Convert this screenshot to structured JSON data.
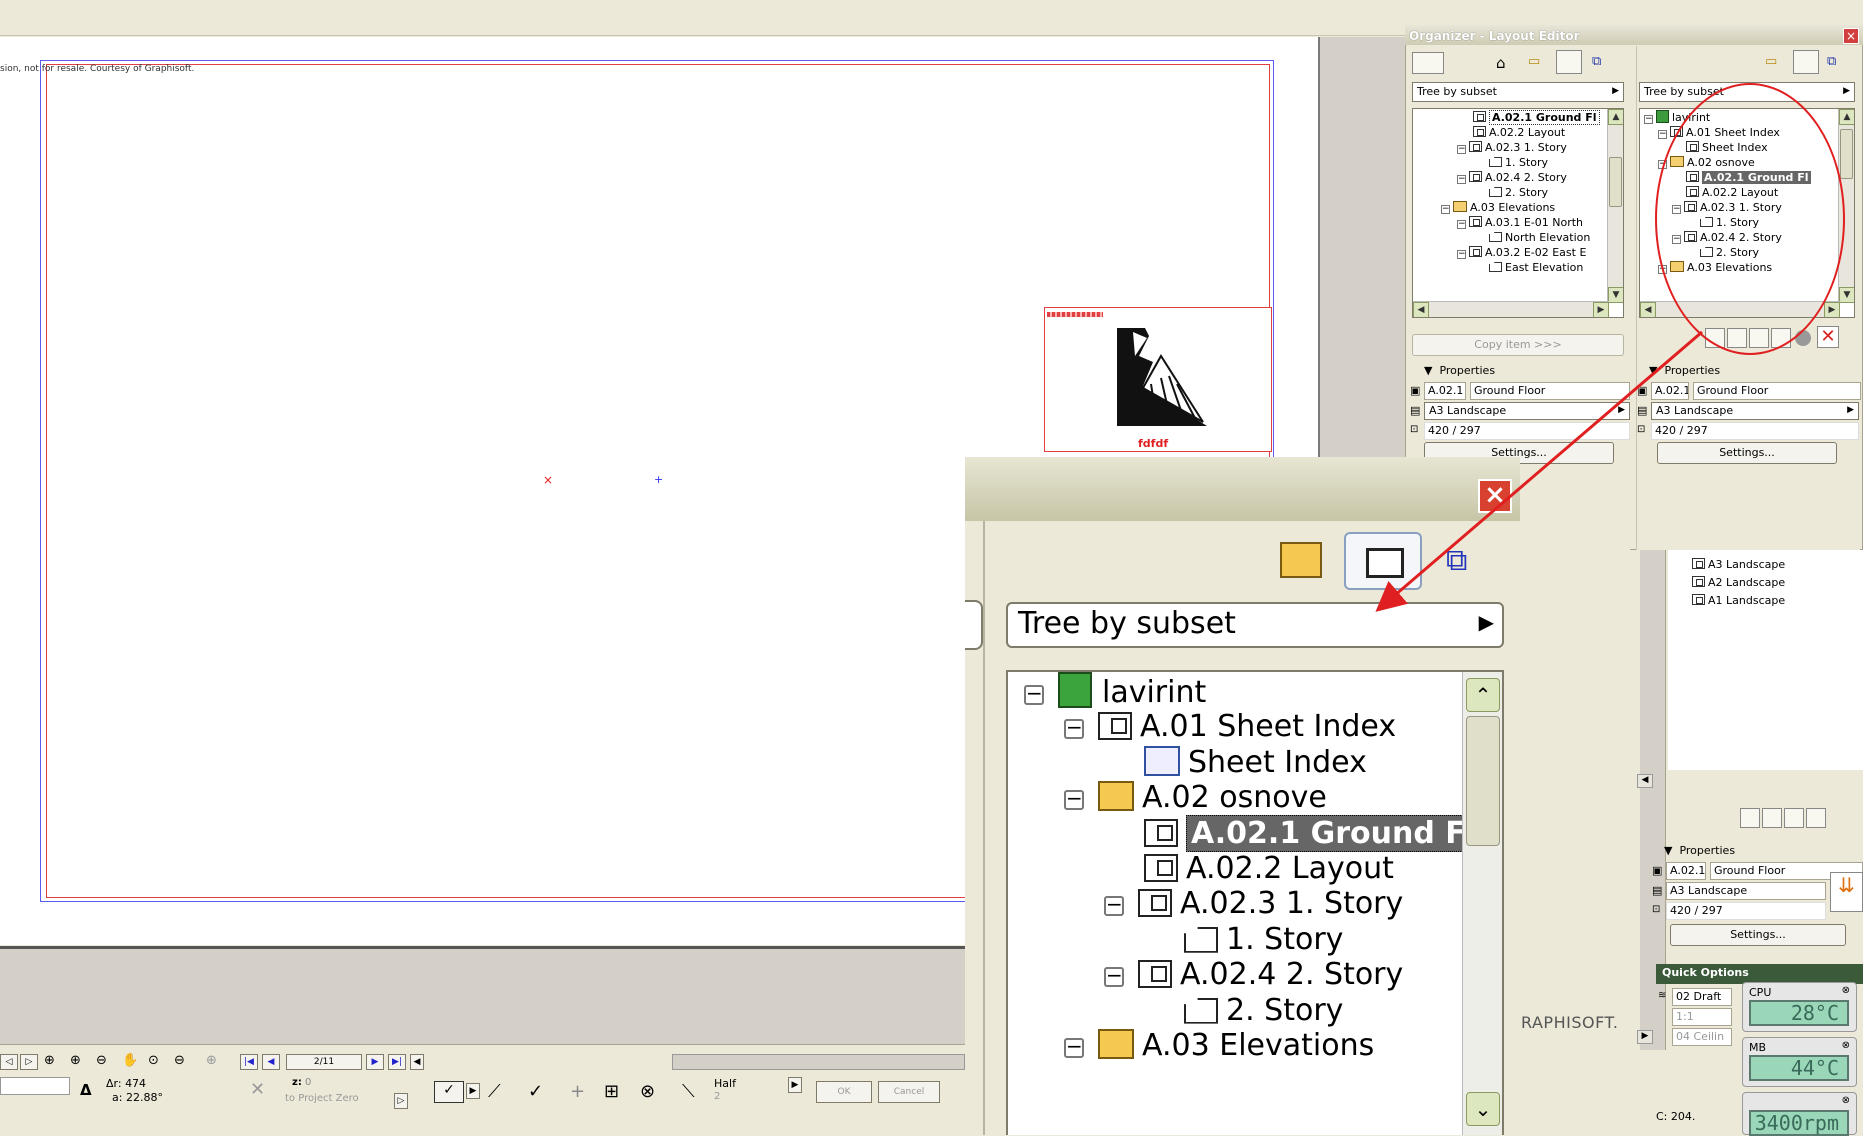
{
  "canvas": {
    "courtesy": "sion, not for resale. Courtesy of Graphisoft.",
    "titleblock_label": "fdfdf"
  },
  "statusbar": {
    "page_counter": "2/11",
    "delta_r_label": "Δr:",
    "delta_r": "474",
    "angle_label": "a:",
    "angle": "22.88°",
    "z_label": "z:",
    "z_value": "0",
    "z_ref": "to Project Zero",
    "half_label": "Half",
    "half_value": "2",
    "ok": "OK",
    "cancel": "Cancel"
  },
  "organizer": {
    "title": "Organizer - Layout Editor",
    "left": {
      "dropdown": "Tree by subset",
      "items": [
        {
          "label": "A.02.1 Ground Fl",
          "indent": 3,
          "icon": "layout",
          "state": "selected"
        },
        {
          "label": "A.02.2 Layout",
          "indent": 3,
          "icon": "layout"
        },
        {
          "label": "A.02.3 1. Story",
          "indent": 2,
          "icon": "layout",
          "exp": "−"
        },
        {
          "label": "1. Story",
          "indent": 4,
          "icon": "view"
        },
        {
          "label": "A.02.4 2. Story",
          "indent": 2,
          "icon": "layout",
          "exp": "−"
        },
        {
          "label": "2. Story",
          "indent": 4,
          "icon": "view"
        },
        {
          "label": "A.03 Elevations",
          "indent": 1,
          "icon": "folder",
          "exp": "−"
        },
        {
          "label": "A.03.1 E-01 North",
          "indent": 2,
          "icon": "layout",
          "exp": "−"
        },
        {
          "label": "North Elevation",
          "indent": 4,
          "icon": "view"
        },
        {
          "label": "A.03.2 E-02 East E",
          "indent": 2,
          "icon": "layout",
          "exp": "−"
        },
        {
          "label": "East Elevation",
          "indent": 4,
          "icon": "view"
        }
      ],
      "copy_btn": "Copy item >>>",
      "properties_title": "Properties",
      "prop_id": "A.02.1",
      "prop_name": "Ground Floor",
      "prop_format": "A3 Landscape",
      "prop_size": "420 / 297",
      "settings": "Settings..."
    },
    "right": {
      "dropdown": "Tree by subset",
      "items": [
        {
          "label": "lavirint",
          "indent": 0,
          "icon": "book",
          "exp": "−"
        },
        {
          "label": "A.01 Sheet Index",
          "indent": 1,
          "icon": "layout",
          "exp": "−"
        },
        {
          "label": "Sheet Index",
          "indent": 3,
          "icon": "index"
        },
        {
          "label": "A.02 osnove",
          "indent": 1,
          "icon": "folder",
          "exp": "−"
        },
        {
          "label": "A.02.1 Ground Fl",
          "indent": 3,
          "icon": "layout",
          "state": "highlight"
        },
        {
          "label": "A.02.2 Layout",
          "indent": 3,
          "icon": "layout"
        },
        {
          "label": "A.02.3 1. Story",
          "indent": 2,
          "icon": "layout",
          "exp": "−"
        },
        {
          "label": "1. Story",
          "indent": 4,
          "icon": "view"
        },
        {
          "label": "A.02.4 2. Story",
          "indent": 2,
          "icon": "layout",
          "exp": "−"
        },
        {
          "label": "2. Story",
          "indent": 4,
          "icon": "view"
        },
        {
          "label": "A.03 Elevations",
          "indent": 1,
          "icon": "folder",
          "exp": "−"
        }
      ],
      "properties_title": "Properties",
      "prop_id": "A.02.1",
      "prop_name": "Ground Floor",
      "prop_format": "A3 Landscape",
      "prop_size": "420 / 297",
      "settings": "Settings..."
    }
  },
  "behind_panel": {
    "masters": [
      "A3 Landscape",
      "A2 Landscape",
      "A1 Landscape"
    ],
    "properties_title": "Properties",
    "prop_id": "A.02.1",
    "prop_name": "Ground Floor",
    "prop_format": "A3 Landscape",
    "prop_size": "420 / 297",
    "settings": "Settings...",
    "quick_options": "Quick Options",
    "quick_1": "02 Draft",
    "quick_2": "1:1",
    "quick_3": "04 Ceilin",
    "brand": "RAPHISOFT.",
    "drive": "C: 204."
  },
  "zoom": {
    "dropdown": "Tree by subset",
    "items": [
      {
        "label": "lavirint",
        "indent": 0,
        "icon": "book",
        "exp": "−"
      },
      {
        "label": "A.01 Sheet Index",
        "indent": 1,
        "icon": "layout",
        "exp": "−"
      },
      {
        "label": "Sheet Index",
        "indent": 3,
        "icon": "index"
      },
      {
        "label": "A.02 osnove",
        "indent": 1,
        "icon": "folder",
        "exp": "−"
      },
      {
        "label": "A.02.1 Ground Fl",
        "indent": 3,
        "icon": "layout",
        "state": "highlight"
      },
      {
        "label": "A.02.2 Layout",
        "indent": 3,
        "icon": "layout"
      },
      {
        "label": "A.02.3 1. Story",
        "indent": 2,
        "icon": "layout",
        "exp": "−"
      },
      {
        "label": "1. Story",
        "indent": 4,
        "icon": "view"
      },
      {
        "label": "A.02.4 2. Story",
        "indent": 2,
        "icon": "layout",
        "exp": "−"
      },
      {
        "label": "2. Story",
        "indent": 4,
        "icon": "view"
      },
      {
        "label": "A.03 Elevations",
        "indent": 1,
        "icon": "folder",
        "exp": "−"
      }
    ]
  },
  "monitors": [
    {
      "label": "CPU",
      "value": "28°C"
    },
    {
      "label": "MB",
      "value": "44°C"
    },
    {
      "label": "",
      "value": "3400rpm"
    }
  ],
  "colors": {
    "annotation": "#e02020",
    "highlight": "#666666",
    "sheet_border": "#5b5bf0"
  }
}
